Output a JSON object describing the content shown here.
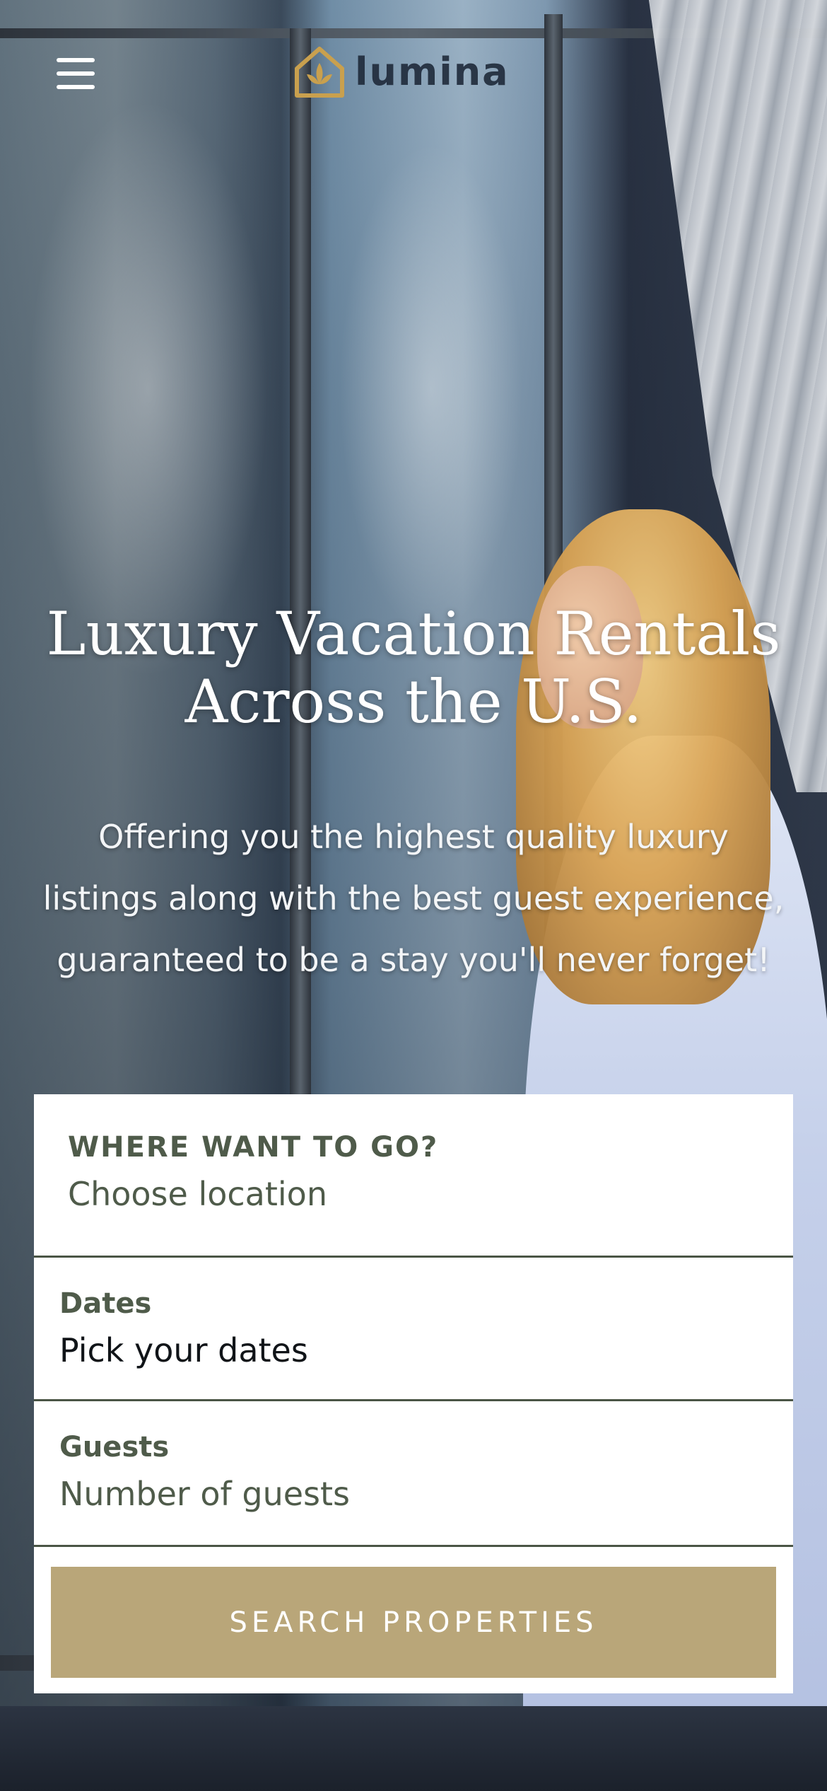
{
  "header": {
    "menu_icon": "hamburger-menu-icon",
    "logo_icon": "house-leaf-logo-icon",
    "logo_text": "Lumina",
    "brand_gold": "#C9A04E"
  },
  "hero": {
    "title": "Luxury Vacation Rentals Across the U.S.",
    "subtitle": "Offering you the highest quality luxury listings along with the best guest experience, guaranteed to be a stay you'll never forget!"
  },
  "search": {
    "location_label": "WHERE WANT TO GO?",
    "location_value": "Choose location",
    "dates_label": "Dates",
    "dates_value": "Pick your dates",
    "guests_label": "Guests",
    "guests_value": "Number of guests",
    "button_label": "SEARCH PROPERTIES",
    "button_color": "#B9A679",
    "label_color": "#4F5B4A"
  }
}
